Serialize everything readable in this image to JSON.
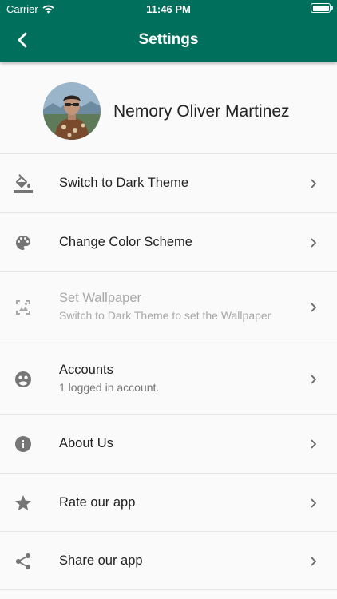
{
  "status": {
    "carrier": "Carrier",
    "time": "11:46 PM"
  },
  "header": {
    "title": "Settings"
  },
  "profile": {
    "name": "Nemory Oliver Martinez"
  },
  "items": [
    {
      "label": "Switch to Dark Theme",
      "icon": "paint-bucket-icon"
    },
    {
      "label": "Change Color Scheme",
      "icon": "palette-icon"
    },
    {
      "label": "Set Wallpaper",
      "sublabel": "Switch to Dark Theme to set the Wallpaper",
      "icon": "wallpaper-icon",
      "disabled": true
    },
    {
      "label": "Accounts",
      "sublabel": "1 logged in account.",
      "icon": "accounts-icon"
    },
    {
      "label": "About Us",
      "icon": "info-icon"
    },
    {
      "label": "Rate our app",
      "icon": "star-icon"
    },
    {
      "label": "Share our app",
      "icon": "share-icon"
    }
  ],
  "colors": {
    "appbar": "#00705c",
    "icon": "#757575",
    "disabled": "#a8a8a8"
  }
}
